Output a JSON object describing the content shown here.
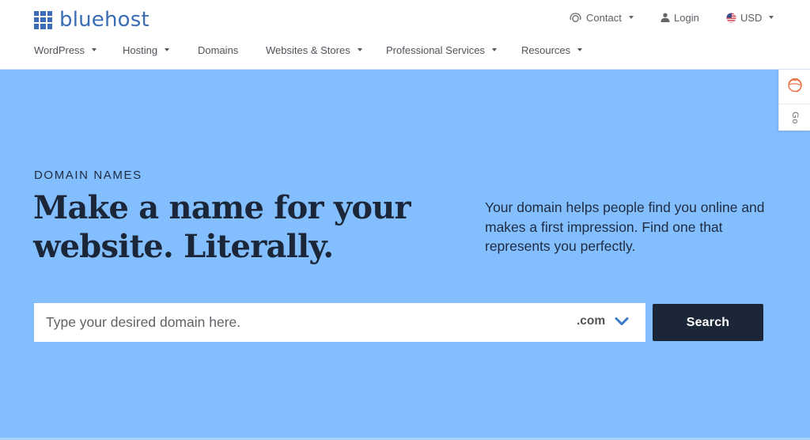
{
  "brand": {
    "name": "bluehost",
    "color": "#3a6db4"
  },
  "utility_nav": {
    "contact": {
      "label": "Contact",
      "icon": "headset-icon"
    },
    "login": {
      "label": "Login",
      "icon": "user-icon"
    },
    "currency": {
      "label": "USD",
      "icon": "us-flag-icon"
    }
  },
  "main_nav": {
    "items": [
      {
        "label": "WordPress",
        "has_dropdown": true
      },
      {
        "label": "Hosting",
        "has_dropdown": true
      },
      {
        "label": "Domains",
        "has_dropdown": false
      },
      {
        "label": "Websites & Stores",
        "has_dropdown": true
      },
      {
        "label": "Professional Services",
        "has_dropdown": true
      },
      {
        "label": "Resources",
        "has_dropdown": true
      }
    ]
  },
  "hero": {
    "background": "#83beff",
    "eyebrow": "DOMAIN NAMES",
    "headline_line1": "Make a name for your",
    "headline_line2": "website. Literally.",
    "description": "Your domain helps people find you online and makes a first impression. Find one that represents you perfectly."
  },
  "domain_search": {
    "placeholder": "Type your desired domain here.",
    "value": "",
    "tld_selected": ".com",
    "button_label": "Search",
    "button_color": "#1b2638"
  },
  "side_widget": {
    "support_icon": "agent-avatar-icon",
    "support_icon_color": "#e8734a",
    "secondary_label": "Go"
  }
}
